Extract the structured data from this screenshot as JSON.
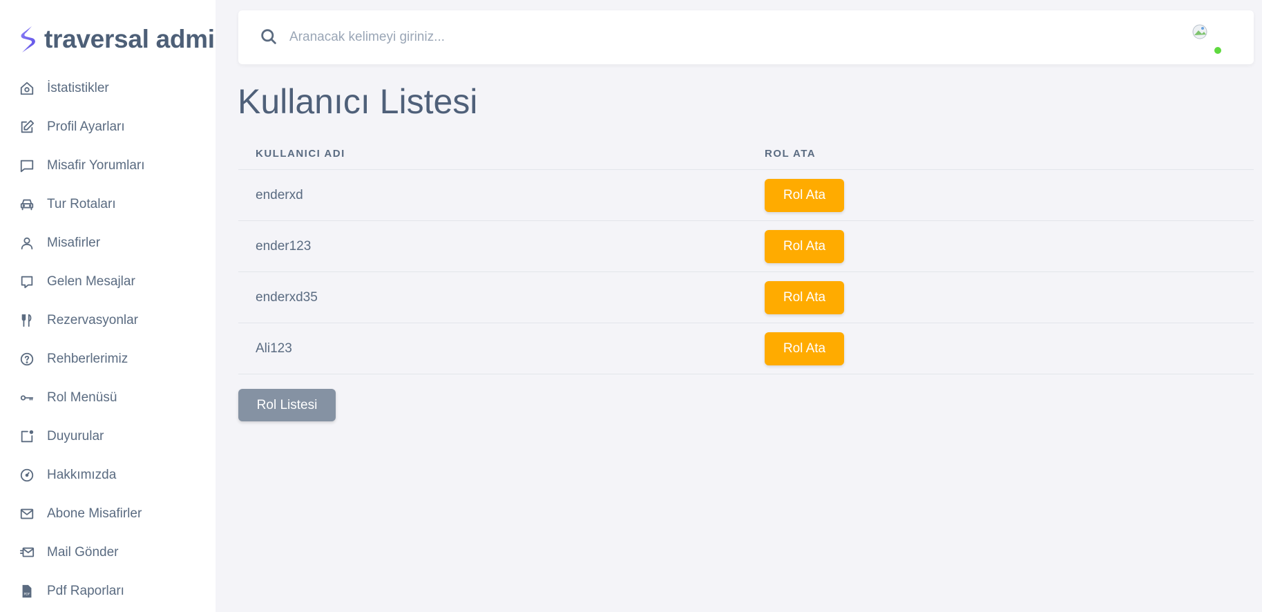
{
  "brand": {
    "name": "traversal admin"
  },
  "sidebar": {
    "items": [
      {
        "label": "İstatistikler",
        "icon": "home-icon"
      },
      {
        "label": "Profil Ayarları",
        "icon": "edit-icon"
      },
      {
        "label": "Misafir Yorumları",
        "icon": "message-icon"
      },
      {
        "label": "Tur Rotaları",
        "icon": "car-icon"
      },
      {
        "label": "Misafirler",
        "icon": "user-icon"
      },
      {
        "label": "Gelen Mesajlar",
        "icon": "chat-icon"
      },
      {
        "label": "Rezervasyonlar",
        "icon": "cutlery-icon"
      },
      {
        "label": "Rehberlerimiz",
        "icon": "help-icon"
      },
      {
        "label": "Rol Menüsü",
        "icon": "key-icon"
      },
      {
        "label": "Duyurular",
        "icon": "notification-icon"
      },
      {
        "label": "Hakkımızda",
        "icon": "gauge-icon"
      },
      {
        "label": "Abone Misafirler",
        "icon": "mail-icon"
      },
      {
        "label": "Mail Gönder",
        "icon": "send-mail-icon"
      },
      {
        "label": "Pdf Raporları",
        "icon": "pdf-icon"
      }
    ]
  },
  "search": {
    "placeholder": "Aranacak kelimeyi giriniz..."
  },
  "page": {
    "title": "Kullanıcı Listesi"
  },
  "table": {
    "headers": [
      "KULLANICI ADI",
      "ROL ATA"
    ],
    "rows": [
      {
        "username": "enderxd",
        "action": "Rol Ata"
      },
      {
        "username": "ender123",
        "action": "Rol Ata"
      },
      {
        "username": "enderxd35",
        "action": "Rol Ata"
      },
      {
        "username": "Ali123",
        "action": "Rol Ata"
      }
    ]
  },
  "footer_button": {
    "label": "Rol Listesi"
  },
  "colors": {
    "accent_orange": "#ffab00",
    "secondary_gray": "#8592a3",
    "brand_purple": "#7367f0",
    "online_green": "#5fd93f"
  }
}
